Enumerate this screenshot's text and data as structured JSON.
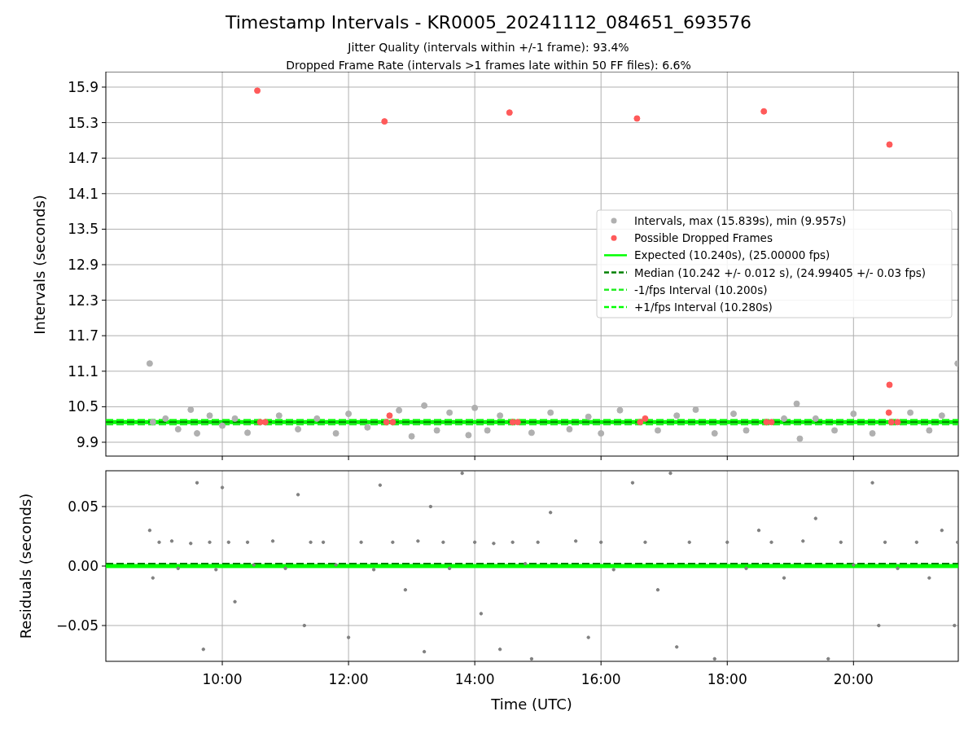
{
  "figure": {
    "title": "Timestamp Intervals - KR0005_20241112_084651_693576",
    "subtitle_lines": [
      "Jitter Quality (intervals within +/-1 frame): 93.4%",
      "Dropped Frame Rate (intervals >1 frames late within 50 FF files): 6.6%"
    ]
  },
  "intervals_panel": {
    "chart_data": {
      "type": "scatter",
      "ylabel": "Intervals (seconds)",
      "xlim": [
        8.155,
        21.66
      ],
      "ylim": [
        9.666,
        16.161
      ],
      "grid": true,
      "legend": true,
      "yticks": [
        {
          "value": 9.9,
          "label": "9.9"
        },
        {
          "value": 10.5,
          "label": "10.5"
        },
        {
          "value": 11.1,
          "label": "11.1"
        },
        {
          "value": 11.7,
          "label": "11.7"
        },
        {
          "value": 12.3,
          "label": "12.3"
        },
        {
          "value": 12.9,
          "label": "12.9"
        },
        {
          "value": 13.5,
          "label": "13.5"
        },
        {
          "value": 14.1,
          "label": "14.1"
        },
        {
          "value": 14.7,
          "label": "14.7"
        },
        {
          "value": 15.3,
          "label": "15.3"
        },
        {
          "value": 15.9,
          "label": "15.9"
        }
      ],
      "series": [
        {
          "name": "Intervals, max (15.839s), min (9.957s)",
          "color": "#b0b0b0",
          "x": [
            8.85,
            8.9,
            9.1,
            9.3,
            9.5,
            9.6,
            9.8,
            10.0,
            10.2,
            10.4,
            10.9,
            11.2,
            11.5,
            11.8,
            12.0,
            12.3,
            12.8,
            13.0,
            13.2,
            13.4,
            13.6,
            13.9,
            14.0,
            14.2,
            14.4,
            14.9,
            15.2,
            15.5,
            15.8,
            16.0,
            16.3,
            16.9,
            17.2,
            17.5,
            17.8,
            18.1,
            18.3,
            18.9,
            19.1,
            19.15,
            19.4,
            19.7,
            20.0,
            20.3,
            20.9,
            21.2,
            21.4,
            21.65
          ],
          "values": [
            11.23,
            10.24,
            10.3,
            10.12,
            10.45,
            10.05,
            10.35,
            10.18,
            10.3,
            10.06,
            10.35,
            10.12,
            10.3,
            10.05,
            10.38,
            10.15,
            10.44,
            10.0,
            10.52,
            10.1,
            10.4,
            10.02,
            10.48,
            10.1,
            10.35,
            10.06,
            10.4,
            10.12,
            10.33,
            10.05,
            10.44,
            10.1,
            10.35,
            10.45,
            10.05,
            10.38,
            10.1,
            10.3,
            10.55,
            9.96,
            10.3,
            10.1,
            10.38,
            10.05,
            10.4,
            10.1,
            10.35,
            11.23
          ]
        },
        {
          "name": "Possible Dropped Frames",
          "color": "#ff5a5a",
          "x": [
            10.555,
            10.6,
            10.68,
            12.57,
            12.6,
            12.65,
            12.7,
            14.55,
            14.6,
            14.68,
            16.57,
            16.62,
            16.7,
            18.58,
            18.62,
            18.7,
            20.57,
            20.57,
            20.56,
            20.6,
            20.7
          ],
          "values": [
            15.84,
            10.24,
            10.24,
            15.32,
            10.24,
            10.35,
            10.24,
            15.47,
            10.24,
            10.24,
            15.37,
            10.24,
            10.3,
            15.49,
            10.24,
            10.24,
            14.93,
            10.87,
            10.4,
            10.24,
            10.24
          ]
        }
      ],
      "ref_lines": [
        {
          "axis": "y",
          "value": 10.24,
          "label": "Expected (10.240s), (25.00000 fps)",
          "color": "#00ff00"
        },
        {
          "axis": "y",
          "value": 10.242,
          "label": "Median (10.242 +/- 0.012 s), (24.99405 +/- 0.03 fps)",
          "color": "#008000"
        },
        {
          "axis": "y",
          "value": 10.2,
          "label": "-1/fps Interval (10.200s)",
          "color": "#22ee22"
        },
        {
          "axis": "y",
          "value": 10.28,
          "label": "+1/fps Interval (10.280s)",
          "color": "#00ff00"
        }
      ]
    }
  },
  "residuals_panel": {
    "chart_data": {
      "type": "scatter",
      "xlabel": "Time (UTC)",
      "ylabel": "Residuals (seconds)",
      "xlim": [
        8.155,
        21.66
      ],
      "ylim": [
        -0.0801,
        0.0801
      ],
      "grid": true,
      "xticks": [
        {
          "value": 10,
          "label": "10:00"
        },
        {
          "value": 12,
          "label": "12:00"
        },
        {
          "value": 14,
          "label": "14:00"
        },
        {
          "value": 16,
          "label": "16:00"
        },
        {
          "value": 18,
          "label": "18:00"
        },
        {
          "value": 20,
          "label": "20:00"
        }
      ],
      "yticks": [
        {
          "value": -0.05,
          "label": "−0.05"
        },
        {
          "value": 0,
          "label": "0.00"
        },
        {
          "value": 0.05,
          "label": "0.05"
        }
      ],
      "series": [
        {
          "color": "#808080",
          "x": [
            8.85,
            8.9,
            9.0,
            9.2,
            9.3,
            9.5,
            9.6,
            9.7,
            9.8,
            9.9,
            10.0,
            10.1,
            10.2,
            10.4,
            10.5,
            10.8,
            11.0,
            11.2,
            11.4,
            11.3,
            11.6,
            11.8,
            12.0,
            12.2,
            12.4,
            12.5,
            12.7,
            12.9,
            13.1,
            13.2,
            13.3,
            13.5,
            13.6,
            13.8,
            14.0,
            14.1,
            14.3,
            14.4,
            14.6,
            14.8,
            14.9,
            15.0,
            15.2,
            15.6,
            15.8,
            16.0,
            16.2,
            16.5,
            16.7,
            16.9,
            17.1,
            17.2,
            17.4,
            17.8,
            18.0,
            18.3,
            18.5,
            18.7,
            18.9,
            19.2,
            19.4,
            19.6,
            19.8,
            20.0,
            20.3,
            20.4,
            20.5,
            20.7,
            21.0,
            21.2,
            21.4,
            21.6,
            21.65
          ],
          "values": [
            0.03,
            -0.01,
            0.02,
            0.021,
            -0.002,
            0.019,
            0.07,
            -0.07,
            0.02,
            -0.003,
            0.066,
            0.02,
            -0.03,
            0.02,
            0.001,
            0.021,
            -0.002,
            0.06,
            0.02,
            -0.05,
            0.02,
            0.001,
            -0.06,
            0.02,
            -0.003,
            0.068,
            0.02,
            -0.02,
            0.021,
            -0.072,
            0.05,
            0.02,
            -0.002,
            0.078,
            0.02,
            -0.04,
            0.019,
            -0.07,
            0.02,
            0.002,
            -0.078,
            0.02,
            0.045,
            0.021,
            -0.06,
            0.02,
            -0.003,
            0.07,
            0.02,
            -0.02,
            0.078,
            -0.068,
            0.02,
            -0.078,
            0.02,
            -0.002,
            0.03,
            0.02,
            -0.01,
            0.021,
            0.04,
            -0.078,
            0.02,
            0.001,
            0.07,
            -0.05,
            0.02,
            -0.002,
            0.02,
            -0.01,
            0.03,
            -0.05,
            0.02
          ]
        }
      ],
      "ref_lines": [
        {
          "axis": "y",
          "value": 0,
          "color": "#00ff00"
        },
        {
          "axis": "y",
          "value": 0.002,
          "color": "#008000"
        }
      ]
    }
  }
}
